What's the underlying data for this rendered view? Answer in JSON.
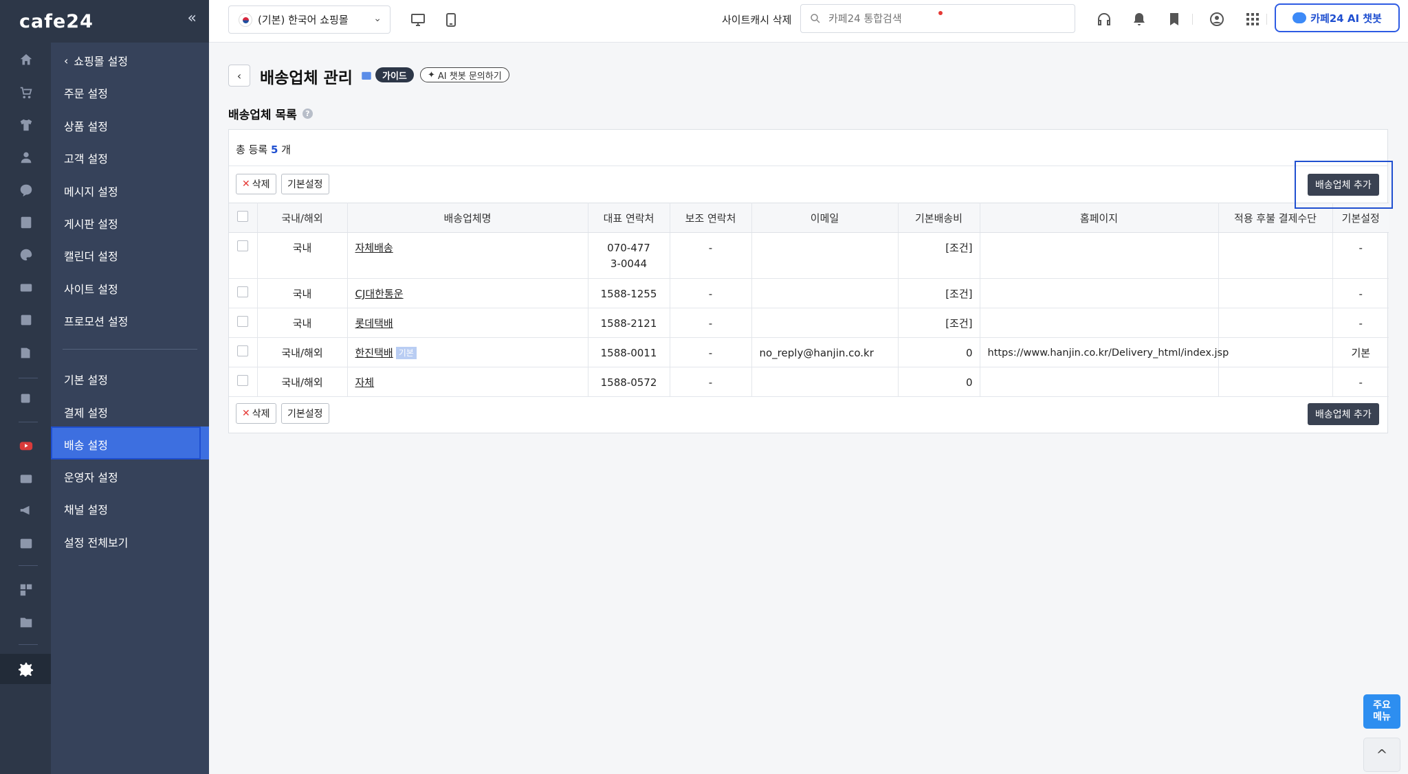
{
  "brand": {
    "logo": "cafe24",
    "collapse": "«"
  },
  "submenu": {
    "back": "쇼핑몰 설정",
    "group1": [
      "주문 설정",
      "상품 설정",
      "고객 설정",
      "메시지 설정",
      "게시판 설정",
      "캘린더 설정",
      "사이트 설정",
      "프로모션 설정"
    ],
    "group2": [
      "기본 설정",
      "결제 설정",
      "배송 설정",
      "운영자 설정",
      "채널 설정",
      "설정 전체보기"
    ],
    "active": "배송 설정"
  },
  "header": {
    "mall": "(기본) 한국어 쇼핑몰",
    "cache_link": "사이트캐시 삭제",
    "search_placeholder": "카페24 통합검색",
    "ai_chatbot": "카페24 AI 챗봇"
  },
  "page": {
    "title": "배송업체 관리",
    "guide": "가이드",
    "ai_inquiry": "AI 챗봇 문의하기",
    "section_title": "배송업체 목록",
    "help": "?"
  },
  "list": {
    "total_prefix": "총 등록",
    "total_count": "5",
    "total_suffix": "개",
    "delete_label": "삭제",
    "default_label": "기본설정",
    "add_label": "배송업체 추가",
    "default_badge": "기본",
    "columns": [
      "국내/해외",
      "배송업체명",
      "대표 연락처",
      "보조 연락처",
      "이메일",
      "기본배송비",
      "홈페이지",
      "적용 후불 결제수단",
      "기본설정"
    ],
    "rows": [
      {
        "region": "국내",
        "name": "자체배송",
        "phone": "070-4773-0044",
        "phone2": "-",
        "email": "",
        "fee": "[조건]",
        "homepage": "",
        "payment": "",
        "default": "-"
      },
      {
        "region": "국내",
        "name": "CJ대한통운",
        "phone": "1588-1255",
        "phone2": "-",
        "email": "",
        "fee": "[조건]",
        "homepage": "",
        "payment": "",
        "default": "-"
      },
      {
        "region": "국내",
        "name": "롯데택배",
        "phone": "1588-2121",
        "phone2": "-",
        "email": "",
        "fee": "[조건]",
        "homepage": "",
        "payment": "",
        "default": "-"
      },
      {
        "region": "국내/해외",
        "name": "한진택배",
        "phone": "1588-0011",
        "phone2": "-",
        "email": "no_reply@hanjin.co.kr",
        "fee": "0",
        "homepage": "https://www.hanjin.co.kr/Delivery_html/index.jsp",
        "payment": "",
        "default": "기본"
      },
      {
        "region": "국내/해외",
        "name": "자체",
        "phone": "1588-0572",
        "phone2": "-",
        "email": "",
        "fee": "0",
        "homepage": "",
        "payment": "",
        "default": "-"
      }
    ]
  },
  "floating": {
    "main_menu_line1": "주요",
    "main_menu_line2": "메뉴",
    "top": "^"
  },
  "colors": {
    "sidebar": "#2d3748",
    "submenu": "#36425a",
    "accent": "#1f4fd0",
    "active_item": "#3d6fe0"
  }
}
